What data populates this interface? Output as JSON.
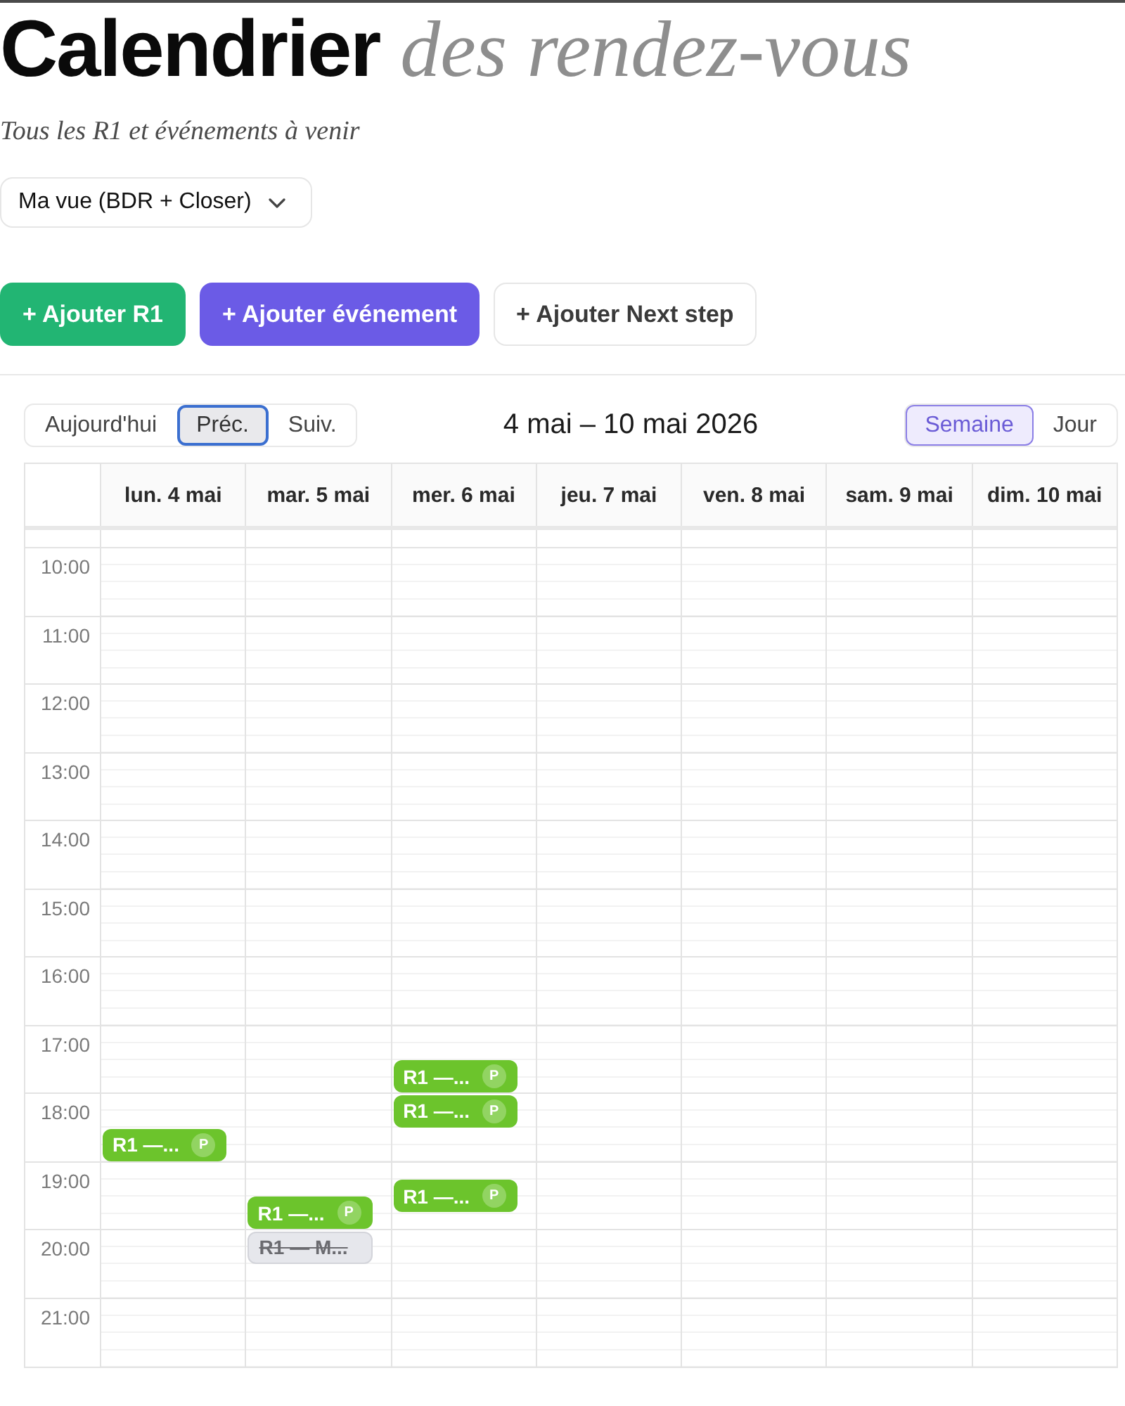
{
  "title": "Calendrier *des rendez-vous*",
  "subtitle": "Tous les R1 et événements à venir",
  "view_select": {
    "value": "Ma vue (BDR + Closer)"
  },
  "actions": [
    {
      "label": "+ Ajouter R1",
      "kind": "success"
    },
    {
      "label": "+ Ajouter événement",
      "kind": "accent"
    },
    {
      "label": "+ Ajouter Next step",
      "kind": "outline"
    }
  ],
  "calendar": {
    "nav": [
      {
        "label": "Aujourd'hui",
        "focused": false
      },
      {
        "label": "Préc.",
        "focused": true
      },
      {
        "label": "Suiv.",
        "focused": false
      }
    ],
    "range": "4 mai – 10 mai 2026",
    "views": [
      {
        "label": "Semaine",
        "selected": true
      },
      {
        "label": "Jour",
        "selected": false
      }
    ],
    "hours": [
      "10:00",
      "11:00",
      "12:00",
      "13:00",
      "14:00",
      "15:00",
      "16:00",
      "17:00",
      "18:00",
      "19:00",
      "20:00",
      "21:00"
    ],
    "days": [
      {
        "label": "lun. 4 mai",
        "slots": [
          {
            "selected": false
          },
          {
            "selected": false
          },
          {
            "selected": false
          },
          {
            "selected": false
          },
          {
            "selected": false
          },
          {
            "selected": false
          },
          {
            "selected": false
          },
          {
            "selected": false
          },
          {
            "selected": false,
            "events": [
              {
                "title": "R1 —...",
                "badge": "P",
                "cancelled": false,
                "half": true,
                "quarter": false
              }
            ]
          },
          {
            "selected": false
          },
          {
            "selected": false
          },
          {
            "selected": false
          }
        ]
      },
      {
        "label": "mar. 5 mai",
        "slots": [
          {
            "selected": false
          },
          {
            "selected": false
          },
          {
            "selected": false
          },
          {
            "selected": false
          },
          {
            "selected": false
          },
          {
            "selected": false
          },
          {
            "selected": false
          },
          {
            "selected": false
          },
          {
            "selected": false
          },
          {
            "selected": false,
            "events": [
              {
                "title": "R1 —...",
                "badge": "P",
                "cancelled": false,
                "half": true,
                "quarter": false
              }
            ]
          },
          {
            "selected": false,
            "events": [
              {
                "title": "R1 — M...",
                "cancelled": true,
                "half": false,
                "quarter": false
              }
            ]
          },
          {
            "selected": false
          }
        ]
      },
      {
        "label": "mer. 6 mai",
        "slots": [
          {
            "selected": false
          },
          {
            "selected": false
          },
          {
            "selected": false
          },
          {
            "selected": false
          },
          {
            "selected": false
          },
          {
            "selected": false
          },
          {
            "selected": false
          },
          {
            "selected": false,
            "events": [
              {
                "title": "R1 —...",
                "badge": "P",
                "cancelled": false,
                "half": true,
                "quarter": false
              }
            ]
          },
          {
            "selected": false,
            "events": [
              {
                "title": "R1 —...",
                "badge": "P",
                "cancelled": false,
                "half": false,
                "quarter": false
              }
            ]
          },
          {
            "selected": false,
            "events": [
              {
                "title": "R1 —...",
                "badge": "P",
                "cancelled": false,
                "half": false,
                "quarter": true
              }
            ]
          },
          {
            "selected": false
          },
          {
            "selected": false
          }
        ]
      },
      {
        "label": "jeu. 7 mai",
        "slots": [
          {
            "selected": false
          },
          {
            "selected": false
          },
          {
            "selected": false
          },
          {
            "selected": false
          },
          {
            "selected": false
          },
          {
            "selected": false
          },
          {
            "selected": false
          },
          {
            "selected": false
          },
          {
            "selected": false
          },
          {
            "selected": false
          },
          {
            "selected": false
          },
          {
            "selected": false
          }
        ]
      },
      {
        "label": "ven. 8 mai",
        "slots": [
          {
            "selected": false
          },
          {
            "selected": false
          },
          {
            "selected": false
          },
          {
            "selected": false
          },
          {
            "selected": false
          },
          {
            "selected": false
          },
          {
            "selected": false
          },
          {
            "selected": false
          },
          {
            "selected": false
          },
          {
            "selected": false
          },
          {
            "selected": false
          },
          {
            "selected": false
          }
        ]
      },
      {
        "label": "sam. 9 mai",
        "slots": [
          {
            "selected": false
          },
          {
            "selected": false
          },
          {
            "selected": false
          },
          {
            "selected": false
          },
          {
            "selected": false
          },
          {
            "selected": false
          },
          {
            "selected": false
          },
          {
            "selected": false
          },
          {
            "selected": false
          },
          {
            "selected": false
          },
          {
            "selected": false
          },
          {
            "selected": false
          }
        ]
      },
      {
        "label": "dim. 10 mai",
        "slots": [
          {
            "selected": false
          },
          {
            "selected": false
          },
          {
            "selected": false
          },
          {
            "selected": false
          },
          {
            "selected": false
          },
          {
            "selected": false
          },
          {
            "selected": false
          },
          {
            "selected": false
          },
          {
            "selected": false
          },
          {
            "selected": false
          },
          {
            "selected": false
          },
          {
            "selected": false
          }
        ]
      }
    ]
  }
}
